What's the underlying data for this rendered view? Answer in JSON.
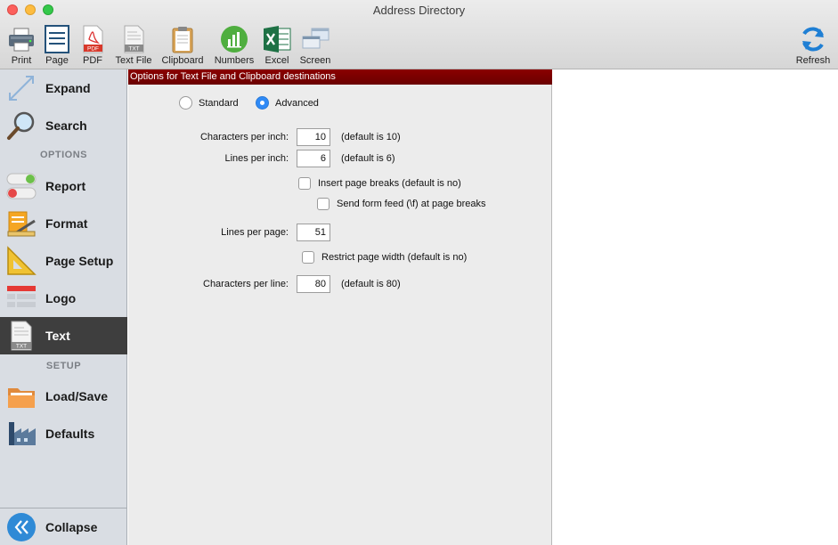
{
  "window": {
    "title": "Address Directory"
  },
  "toolbar": {
    "print": "Print",
    "page": "Page",
    "pdf": "PDF",
    "text_file": "Text File",
    "clipboard": "Clipboard",
    "numbers": "Numbers",
    "excel": "Excel",
    "screen": "Screen",
    "refresh": "Refresh",
    "pdf_icon_text": "PDF",
    "txt_icon_text": "TXT"
  },
  "sidebar": {
    "expand": "Expand",
    "search": "Search",
    "options_header": "OPTIONS",
    "report": "Report",
    "format": "Format",
    "page_setup": "Page Setup",
    "logo": "Logo",
    "text": "Text",
    "setup_header": "SETUP",
    "load_save": "Load/Save",
    "defaults": "Defaults",
    "collapse": "Collapse",
    "txt_icon_text": "TXT"
  },
  "panel": {
    "header": "Options for Text File and Clipboard destinations",
    "mode": {
      "standard": "Standard",
      "advanced": "Advanced",
      "selected": "Advanced"
    },
    "chars_per_inch": {
      "label": "Characters per inch:",
      "value": "10",
      "hint": "(default is 10)"
    },
    "lines_per_inch": {
      "label": "Lines per inch:",
      "value": "6",
      "hint": "(default is 6)"
    },
    "insert_page_breaks": {
      "label": "Insert page breaks (default is no)",
      "checked": false
    },
    "send_form_feed": {
      "label": "Send form feed (\\f) at page breaks",
      "checked": false
    },
    "lines_per_page": {
      "label": "Lines per page:",
      "value": "51"
    },
    "restrict_width": {
      "label": "Restrict page width (default is no)",
      "checked": false
    },
    "chars_per_line": {
      "label": "Characters per line:",
      "value": "80",
      "hint": "(default is 80)"
    }
  },
  "colors": {
    "header_bg": "#8b0000",
    "active_item_bg": "#3e3e3e",
    "radio_accent": "#2f8af6",
    "sidebar_bg": "#d9dde3"
  }
}
